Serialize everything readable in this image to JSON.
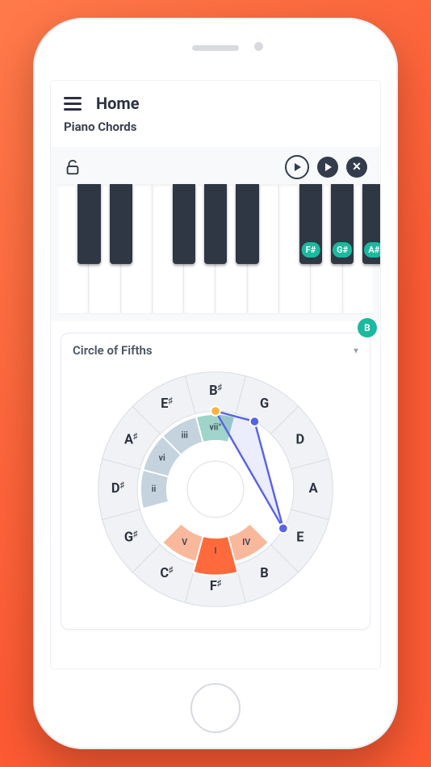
{
  "header": {
    "title": "Home",
    "subtitle": "Piano Chords"
  },
  "toolbar": {
    "lock_state": "unlocked"
  },
  "keyboard": {
    "white_count": 10,
    "black_keys": [
      {
        "pos": 6.5
      },
      {
        "pos": 16.5
      },
      {
        "pos": 36.5
      },
      {
        "pos": 46.5
      },
      {
        "pos": 56.5
      },
      {
        "pos": 76.5,
        "label": "F#",
        "highlighted": true
      },
      {
        "pos": 86.5,
        "label": "G#",
        "highlighted": true
      },
      {
        "pos": 96.5,
        "label": "A#",
        "highlighted": true
      }
    ],
    "floating_note": {
      "label": "B"
    }
  },
  "card": {
    "title": "Circle of Fifths"
  },
  "chart_data": {
    "type": "circle_of_fifths",
    "title": "Circle of Fifths",
    "outer_ring": [
      "B#",
      "G",
      "D",
      "A",
      "E",
      "B",
      "F#",
      "C#",
      "G#",
      "D#",
      "A#",
      "E#"
    ],
    "inner_ring": [
      "vii°",
      "",
      "",
      "",
      "",
      "IV",
      "I",
      "V",
      "",
      "ii",
      "vi",
      "iii"
    ],
    "inner_colors": [
      "teal",
      "",
      "",
      "",
      "",
      "orange",
      "orange-strong",
      "orange",
      "",
      "blue",
      "blue",
      "blue"
    ],
    "selected_root": "F#",
    "triangle_nodes": [
      "B#",
      "G",
      "E"
    ],
    "highlight_node": "B#"
  }
}
